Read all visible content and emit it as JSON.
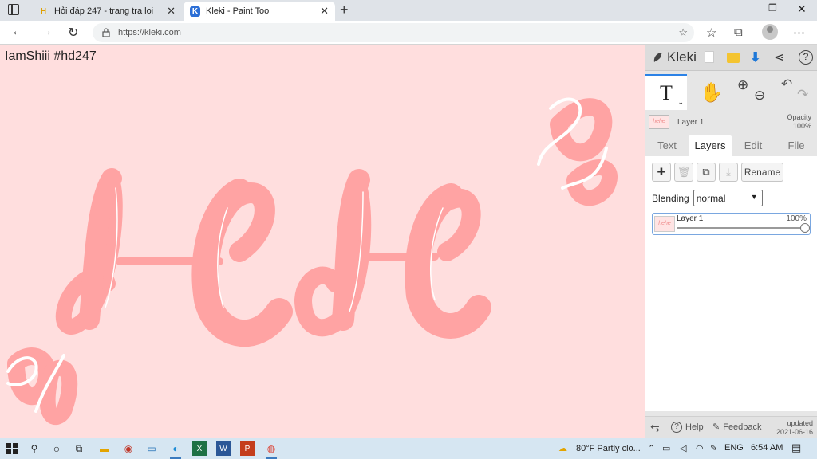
{
  "browser": {
    "tabs": [
      {
        "title": "Hỏi đáp 247 - trang tra loi",
        "favicon": "H"
      },
      {
        "title": "Kleki - Paint Tool",
        "favicon": "K"
      }
    ],
    "new_tab": "+",
    "url": "https://kleki.com"
  },
  "canvas": {
    "watermark": "IamShiii #hd247",
    "colors": {
      "background": "#ffdede",
      "stroke": "#ffa3a3",
      "highlight": "#ffffff"
    }
  },
  "app": {
    "logo": "Kleki",
    "tool_label": "T",
    "status": {
      "layer_name": "Layer 1",
      "opacity_label": "Opacity",
      "opacity_value": "100%"
    },
    "tabs": [
      "Text",
      "Layers",
      "Edit",
      "File"
    ],
    "active_tab": "Layers",
    "layer_buttons": {
      "rename": "Rename"
    },
    "blending": {
      "label": "Blending",
      "value": "normal"
    },
    "layers": [
      {
        "name": "Layer 1",
        "opacity": "100%"
      }
    ],
    "bottom": {
      "help": "Help",
      "feedback": "Feedback",
      "updated_label": "updated",
      "updated_date": "2021-06-16"
    }
  },
  "taskbar": {
    "weather": "80°F  Partly clo...",
    "lang": "ENG",
    "time": "6:54 AM"
  }
}
